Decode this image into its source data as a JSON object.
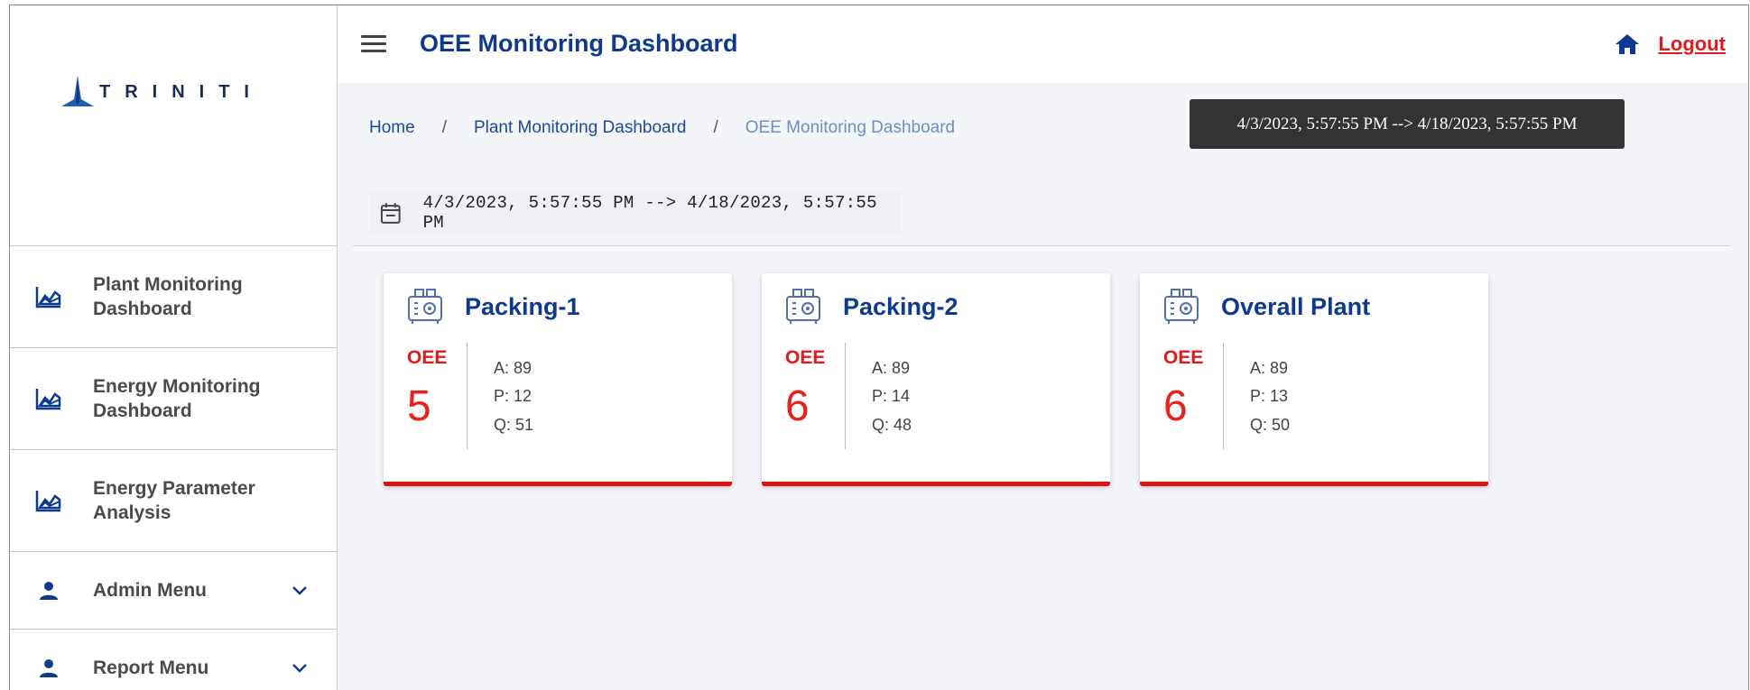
{
  "brand": {
    "name": "TRINITI"
  },
  "header": {
    "title": "OEE Monitoring Dashboard",
    "logout_label": "Logout"
  },
  "sidebar": {
    "items": [
      {
        "label": "Plant Monitoring Dashboard",
        "icon": "chart-area-icon"
      },
      {
        "label": "Energy Monitoring Dashboard",
        "icon": "chart-area-icon"
      },
      {
        "label": "Energy Parameter Analysis",
        "icon": "chart-area-icon"
      },
      {
        "label": "Admin Menu",
        "icon": "person-icon"
      },
      {
        "label": "Report Menu",
        "icon": "person-icon"
      }
    ]
  },
  "breadcrumb": {
    "items": [
      "Home",
      "Plant Monitoring Dashboard",
      "OEE Monitoring Dashboard"
    ],
    "separator": "/"
  },
  "tooltip": {
    "text": "4/3/2023, 5:57:55 PM --> 4/18/2023, 5:57:55 PM"
  },
  "date_range": {
    "text": "4/3/2023, 5:57:55 PM --> 4/18/2023, 5:57:55 PM"
  },
  "cards": [
    {
      "title": "Packing-1",
      "oee_label": "OEE",
      "oee_value": "5",
      "a": "A: 89",
      "p": "P: 12",
      "q": "Q: 51"
    },
    {
      "title": "Packing-2",
      "oee_label": "OEE",
      "oee_value": "6",
      "a": "A: 89",
      "p": "P: 14",
      "q": "Q: 48"
    },
    {
      "title": "Overall Plant",
      "oee_label": "OEE",
      "oee_value": "6",
      "a": "A: 89",
      "p": "P: 13",
      "q": "Q: 50"
    }
  ],
  "colors": {
    "primary": "#0d3a8c",
    "accent": "#e01a1a",
    "background": "#f4f5f8",
    "tooltip_bg": "#333333"
  }
}
